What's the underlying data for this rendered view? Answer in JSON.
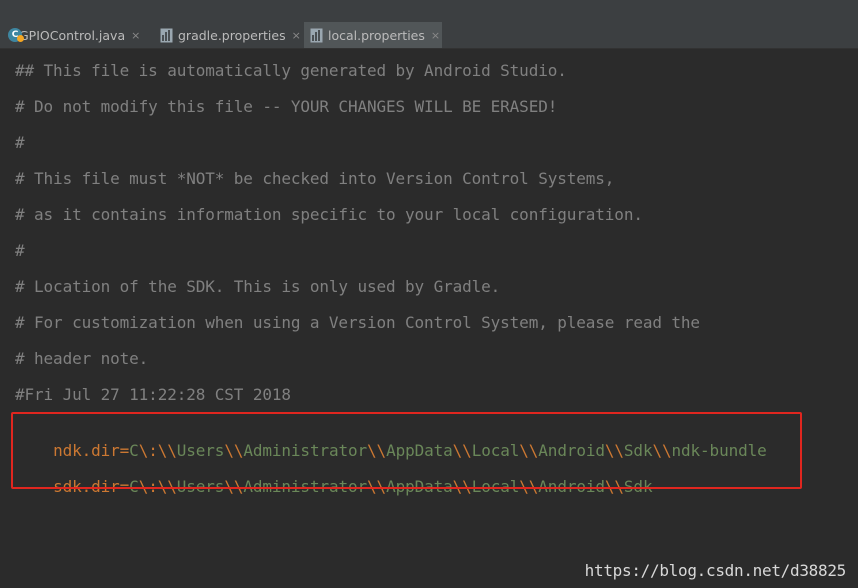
{
  "tabs": [
    {
      "label": "GPIOControl.java",
      "icon": "java-class-icon",
      "active": false
    },
    {
      "label": "gradle.properties",
      "icon": "properties-file-icon",
      "active": false
    },
    {
      "label": "local.properties",
      "icon": "properties-file-icon",
      "active": true
    }
  ],
  "close_glyph": "×",
  "editor": {
    "comments": [
      "## This file is automatically generated by Android Studio.",
      "# Do not modify this file -- YOUR CHANGES WILL BE ERASED!",
      "#",
      "# This file must *NOT* be checked into Version Control Systems,",
      "# as it contains information specific to your local configuration.",
      "#",
      "# Location of the SDK. This is only used by Gradle.",
      "# For customization when using a Version Control System, please read the",
      "# header note.",
      "#Fri Jul 27 11:22:28 CST 2018"
    ],
    "properties": [
      {
        "key": "ndk.dir",
        "value": "C\\:\\\\Users\\\\Administrator\\\\AppData\\\\Local\\\\Android\\\\Sdk\\\\ndk-bundle"
      },
      {
        "key": "sdk.dir",
        "value": "C\\:\\\\Users\\\\Administrator\\\\AppData\\\\Local\\\\Android\\\\Sdk"
      }
    ]
  },
  "watermark": "https://blog.csdn.net/d38825",
  "colors": {
    "background": "#2b2b2b",
    "comment": "#808080",
    "key": "#cc7832",
    "value": "#6a8759",
    "highlight": "#e0261f"
  }
}
